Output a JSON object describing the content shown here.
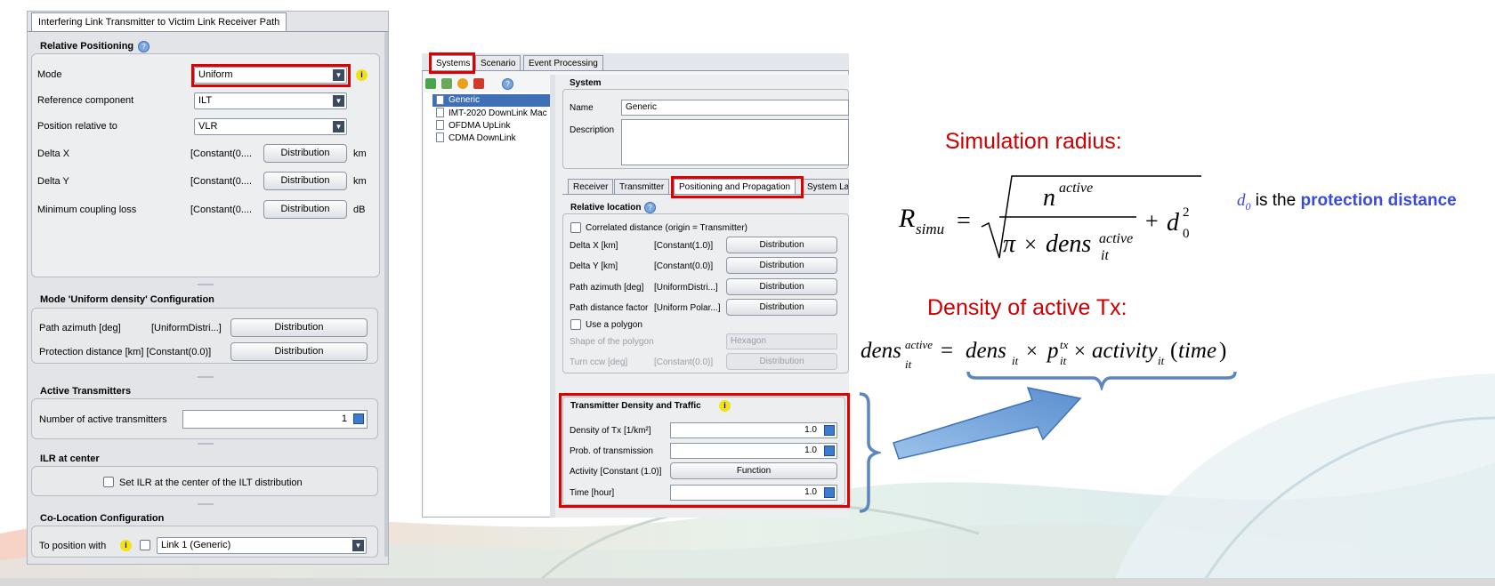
{
  "left_panel": {
    "tab": "Interfering Link Transmitter to Victim Link Receiver Path",
    "relpos_title": "Relative Positioning",
    "mode_label": "Mode",
    "mode_value": "Uniform",
    "ref_label": "Reference component",
    "ref_value": "ILT",
    "posrel_label": "Position relative to",
    "posrel_value": "VLR",
    "dx_label": "Delta X",
    "dx_value": "[Constant(0....",
    "dx_btn": "Distribution",
    "dx_unit": "km",
    "dy_label": "Delta Y",
    "dy_value": "[Constant(0....",
    "dy_btn": "Distribution",
    "dy_unit": "km",
    "mcl_label": "Minimum coupling loss",
    "mcl_value": "[Constant(0....",
    "mcl_btn": "Distribution",
    "mcl_unit": "dB",
    "mode_cfg_title": "Mode 'Uniform density' Configuration",
    "pathaz_label": "Path azimuth [deg]",
    "pathaz_value": "[UniformDistri...]",
    "pathaz_btn": "Distribution",
    "protd_label": "Protection distance [km] [Constant(0.0)]",
    "protd_btn": "Distribution",
    "active_title": "Active Transmitters",
    "nat_label": "Number of active transmitters",
    "nat_value": "1",
    "ilr_title": "ILR at center",
    "ilr_check": "Set ILR at the center of the ILT distribution",
    "coloc_title": "Co-Location Configuration",
    "toposition_label": "To position with",
    "link_value": "Link 1 (Generic)"
  },
  "mid_panel": {
    "tabs": [
      "Systems",
      "Scenario",
      "Event Processing"
    ],
    "tree": [
      "Generic",
      "IMT-2020 DownLink Mac",
      "OFDMA UpLink",
      "CDMA DownLink"
    ],
    "system_title": "System",
    "name_label": "Name",
    "name_value": "Generic",
    "desc_label": "Description",
    "subtabs": [
      "Receiver",
      "Transmitter",
      "Positioning and Propagation",
      "System La"
    ],
    "relloc_title": "Relative location",
    "corr_label": "Correlated distance (origin = Transmitter)",
    "rows": [
      {
        "label": "Delta X [km]",
        "value": "[Constant(1.0)]",
        "btn": "Distribution"
      },
      {
        "label": "Delta Y [km]",
        "value": "[Constant(0.0)]",
        "btn": "Distribution"
      },
      {
        "label": "Path azimuth [deg]",
        "value": "[UniformDistri...]",
        "btn": "Distribution"
      },
      {
        "label": "Path distance factor",
        "value": "[Uniform Polar...]",
        "btn": "Distribution"
      }
    ],
    "poly_label": "Use a polygon",
    "shape_label": "Shape of the polygon",
    "shape_value": "Hexagon",
    "turn_label": "Turn ccw [deg]",
    "turn_value": "[Constant(0.0)]",
    "turn_btn": "Distribution",
    "tdt_title": "Transmitter Density and Traffic",
    "dens_label": "Density of Tx [1/km²]",
    "dens_value": "1.0",
    "prob_label": "Prob. of transmission",
    "prob_value": "1.0",
    "act_label": "Activity   [Constant (1.0)]",
    "act_btn": "Function",
    "time_label": "Time [hour]",
    "time_value": "1.0"
  },
  "annotations": {
    "sim_radius": "Simulation radius:",
    "density_title": "Density of active Tx:",
    "d0_label": "d",
    "d0_sub": "0",
    "d0_text": " is the ",
    "d0_bold": "protection distance"
  },
  "colors": {
    "red": "#cc0000",
    "blue": "#3a4bdb",
    "highlight": "#e00000"
  }
}
